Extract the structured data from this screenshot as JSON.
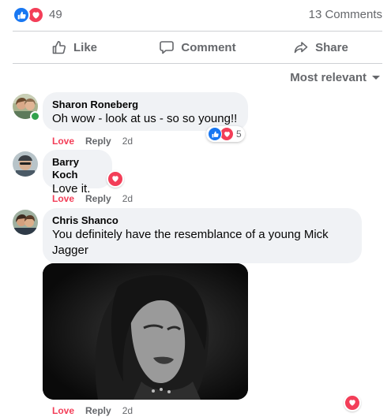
{
  "summary": {
    "reaction_count": "49",
    "comments_count": "13 Comments",
    "reaction_icons": [
      "like-icon",
      "love-icon"
    ]
  },
  "actions": {
    "like_label": "Like",
    "comment_label": "Comment",
    "share_label": "Share"
  },
  "sort": {
    "label": "Most relevant"
  },
  "comments": [
    {
      "author": "Sharon Roneberg",
      "text": "Oh wow - look at us - so so young!!",
      "love_label": "Love",
      "reply_label": "Reply",
      "time": "2d",
      "reaction_count": "5",
      "reactions": [
        "like-icon",
        "love-icon"
      ],
      "online": true
    },
    {
      "author": "Barry Koch",
      "text": "Love it.",
      "love_label": "Love",
      "reply_label": "Reply",
      "time": "2d",
      "reactions": [
        "love-icon"
      ]
    },
    {
      "author": "Chris Shanco",
      "text": "You definitely have the resemblance of a young Mick Jagger",
      "love_label": "Love",
      "reply_label": "Reply",
      "time": "2d",
      "reactions": [
        "love-icon"
      ],
      "attachment": "black-and-white-photo"
    }
  ],
  "colors": {
    "like_blue": "#1877f2",
    "love_red": "#f33e58",
    "secondary_text": "#65676b",
    "bubble_bg": "#f0f2f5",
    "online_green": "#31a24c"
  }
}
